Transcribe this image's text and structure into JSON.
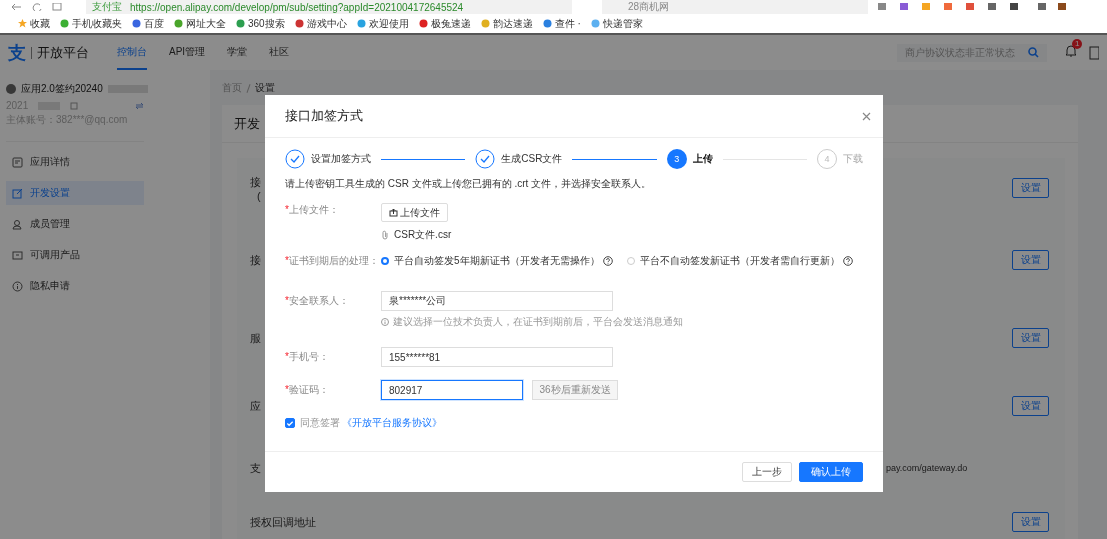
{
  "browser": {
    "site_chip": "支付宝",
    "url": "https://open.alipay.com/develop/pm/sub/setting?appId=2021004172645524",
    "search_text": "28商机网",
    "bookmarks": [
      {
        "label": "收藏"
      },
      {
        "label": "手机收藏夹"
      },
      {
        "label": "百度"
      },
      {
        "label": "网址大全"
      },
      {
        "label": "360搜索"
      },
      {
        "label": "游戏中心"
      },
      {
        "label": "欢迎使用"
      },
      {
        "label": "极兔速递"
      },
      {
        "label": "韵达速递"
      },
      {
        "label": "查件 ·"
      },
      {
        "label": "快递管家"
      }
    ]
  },
  "app_header": {
    "logo_mark": "支",
    "logo_text": "开放平台",
    "nav": [
      {
        "label": "控制台",
        "selected": true
      },
      {
        "label": "API管理",
        "selected": false
      },
      {
        "label": "学堂",
        "selected": false
      },
      {
        "label": "社区",
        "selected": false
      }
    ],
    "search": {
      "placeholder": "商户协议状态非正常状态"
    },
    "notification_count": "1"
  },
  "sidebar": {
    "app_name": "应用2.0签约20240",
    "app_id": "2021",
    "account": "主体账号：382***@qq.com",
    "items": [
      {
        "label": "应用详情",
        "selected": false
      },
      {
        "label": "开发设置",
        "selected": true
      },
      {
        "label": "成员管理",
        "selected": false
      },
      {
        "label": "可调用产品",
        "selected": false
      },
      {
        "label": "隐私申请",
        "selected": false
      }
    ]
  },
  "main": {
    "breadcrumb": [
      "首页",
      "设置"
    ],
    "card_title": "开发",
    "rows": [
      {
        "label_lines": [
          "接",
          "("
        ],
        "button": "设置"
      },
      {
        "label_lines": [
          "接"
        ],
        "button": "设置"
      },
      {
        "label_lines": [
          "服"
        ],
        "button": "设置"
      },
      {
        "label_lines": [
          "应"
        ],
        "button": "设置"
      },
      {
        "label_lines": [
          "支"
        ],
        "value": "pay.com/gateway.do"
      },
      {
        "label_lines": [
          "授权回调地址"
        ],
        "button": "设置"
      }
    ]
  },
  "modal": {
    "title": "接口加签方式",
    "steps": [
      {
        "label": "设置加签方式",
        "completed": true,
        "active": false
      },
      {
        "label": "生成CSR文件",
        "completed": true,
        "active": false
      },
      {
        "number": "3",
        "label": "上传",
        "completed": false,
        "active": true
      },
      {
        "number": "4",
        "label": "下载",
        "completed": false,
        "active": false
      }
    ],
    "description": "请上传密钥工具生成的 CSR 文件或上传您已拥有的 .crt 文件，并选择安全联系人。",
    "upload": {
      "mark": "*",
      "label": "上传文件：",
      "button": "上传文件",
      "file": "CSR文件.csr"
    },
    "expiry": {
      "mark": "*",
      "label": "证书到期后的处理：",
      "options": [
        {
          "label": "平台自动签发5年期新证书（开发者无需操作）",
          "selected": true
        },
        {
          "label": "平台不自动签发新证书（开发者需自行更新）",
          "selected": false
        }
      ]
    },
    "contact": {
      "mark": "*",
      "label": "安全联系人：",
      "value": "泉*******公司",
      "hint": "建议选择一位技术负责人，在证书到期前后，平台会发送消息通知"
    },
    "phone": {
      "mark": "*",
      "label": "手机号：",
      "value": "155******81"
    },
    "code": {
      "mark": "*",
      "label": "验证码：",
      "value": "802917",
      "focused": true,
      "resend": {
        "label": "36秒后重新发送",
        "disabled": true
      }
    },
    "agreement": {
      "checked": true,
      "text": "同意签署",
      "link": "《开放平台服务协议》"
    },
    "buttons": [
      {
        "label": "上一步",
        "kind": "default"
      },
      {
        "label": "确认上传",
        "kind": "primary"
      }
    ]
  }
}
